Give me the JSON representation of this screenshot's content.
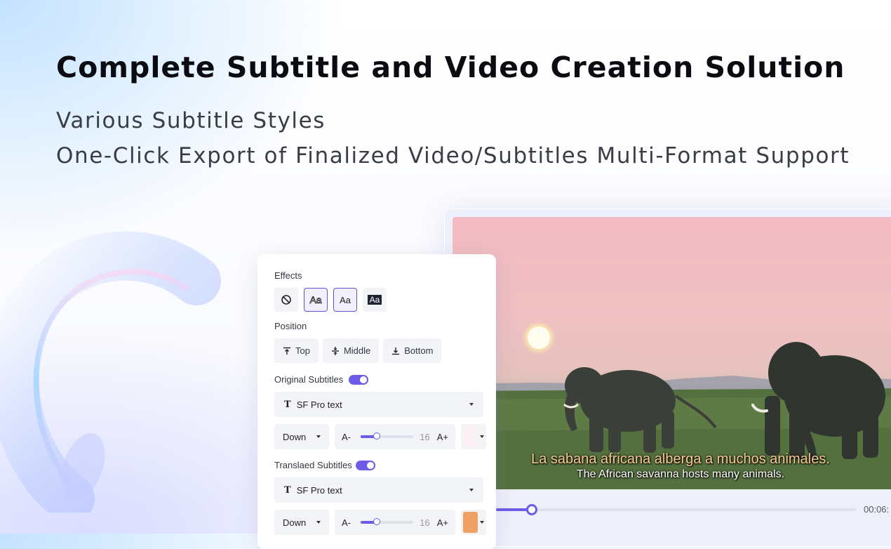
{
  "hero": {
    "title": "Complete Subtitle and Video Creation Solution",
    "line1": "Various Subtitle Styles",
    "line2": "One-Click Export of Finalized Video/Subtitles Multi-Format Support"
  },
  "video": {
    "caption_original": "La sabana africana alberga a muchos animales.",
    "caption_translated": "The African savanna hosts many animals.",
    "timecode": "00:06:",
    "progress": 0.1
  },
  "panel": {
    "effects_label": "Effects",
    "effects": [
      {
        "icon": "no-effect-icon",
        "text": ""
      },
      {
        "icon": "outline-text-icon",
        "text": "Aa"
      },
      {
        "icon": "plain-text-icon",
        "text": "Aa"
      },
      {
        "icon": "background-text-icon",
        "text": "Aa"
      }
    ],
    "position_label": "Position",
    "positions": [
      {
        "icon": "align-top-icon",
        "label": "Top"
      },
      {
        "icon": "align-middle-icon",
        "label": "Middle"
      },
      {
        "icon": "align-bottom-icon",
        "label": "Bottom"
      }
    ],
    "original": {
      "label": "Original Subtitles",
      "enabled": true,
      "font": "SF Pro text",
      "direction": "Down",
      "size_minus": "A-",
      "size_plus": "A+",
      "size": "16",
      "size_level": 0.3,
      "color": "#fbf0f3"
    },
    "translated": {
      "label": "Translaed Subtitles",
      "enabled": true,
      "font": "SF Pro text",
      "direction": "Down",
      "size_minus": "A-",
      "size_plus": "A+",
      "size": "16",
      "size_level": 0.3,
      "color": "#f0a062"
    }
  },
  "colors": {
    "accent": "#6c5ce7"
  }
}
